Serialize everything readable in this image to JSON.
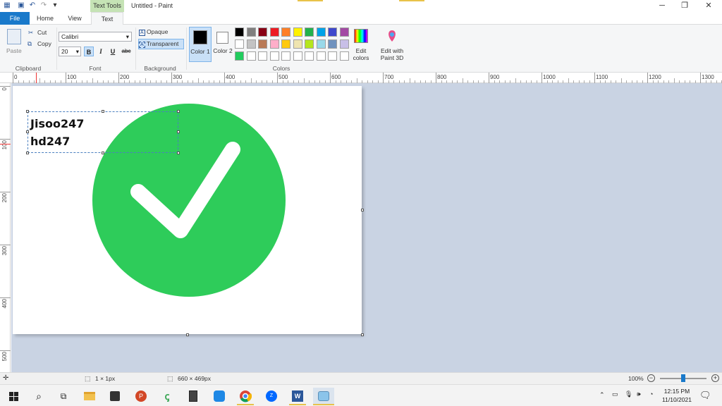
{
  "titlebar": {
    "tool_context": "Text Tools",
    "title": "Untitled - Paint",
    "minimize": "─",
    "maximize": "❐",
    "close": "✕"
  },
  "tabs": {
    "file": "File",
    "home": "Home",
    "view": "View",
    "text": "Text"
  },
  "clipboard": {
    "paste": "Paste",
    "cut": "Cut",
    "copy": "Copy",
    "group": "Clipboard"
  },
  "font": {
    "family": "Calibri",
    "size": "20",
    "bold": "B",
    "italic": "I",
    "underline": "U",
    "strike": "abc",
    "group": "Font"
  },
  "background": {
    "opaque": "Opaque",
    "transparent": "Transparent",
    "group": "Background"
  },
  "colors": {
    "color1": "Color 1",
    "color2": "Color 2",
    "edit": "Edit colors",
    "paint3d": "Edit with Paint 3D",
    "group": "Colors",
    "palette_row1": [
      "#000000",
      "#7f7f7f",
      "#880015",
      "#ed1c24",
      "#ff7f27",
      "#fff200",
      "#22b14c",
      "#00a2e8",
      "#3f48cc",
      "#a349a4"
    ],
    "palette_row2": [
      "#ffffff",
      "#c3c3c3",
      "#b97a57",
      "#ffaec9",
      "#ffc90e",
      "#efe4b0",
      "#b5e61d",
      "#99d9ea",
      "#7092be",
      "#c8bfe7"
    ],
    "palette_row3": [
      "#22cc5e",
      "#ffffff",
      "#ffffff",
      "#ffffff",
      "#ffffff",
      "#ffffff",
      "#ffffff",
      "#ffffff",
      "#ffffff",
      "#ffffff"
    ]
  },
  "ruler_top": [
    "0",
    "100",
    "200",
    "300",
    "400",
    "500",
    "600",
    "700",
    "800",
    "900",
    "1000",
    "1100",
    "1200",
    "1300"
  ],
  "ruler_left": [
    "0",
    "100",
    "200",
    "300",
    "400",
    "500"
  ],
  "canvas": {
    "text": "Jisoo247\nhd247",
    "check_color": "#2ecc5a"
  },
  "status": {
    "selection": "1 × 1px",
    "size": "660 × 469px",
    "zoom": "100%"
  },
  "taskbar": {
    "time": "12:15 PM",
    "date": "11/10/2021"
  }
}
